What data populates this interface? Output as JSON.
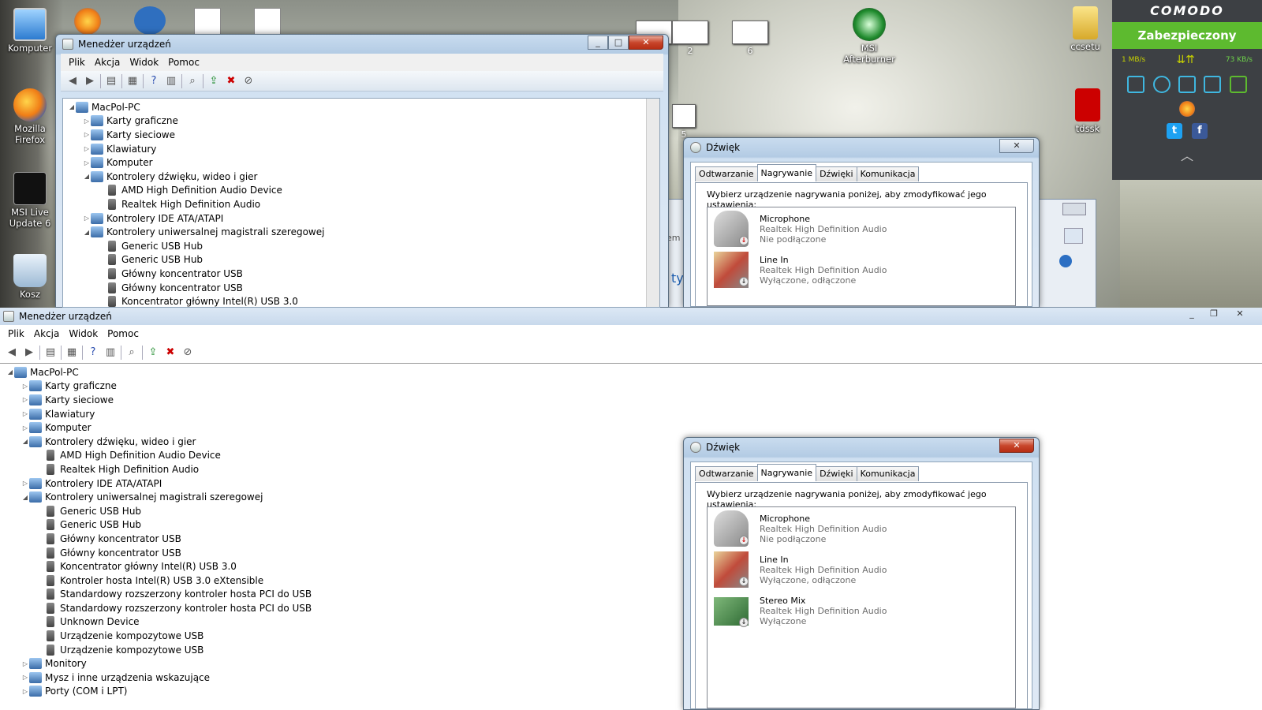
{
  "desktop": {
    "icons": [
      {
        "label": "Komputer"
      },
      {
        "label": "Mozilla Firefox"
      },
      {
        "label": "MSI Live Update 6"
      },
      {
        "label": "Kosz"
      },
      {
        "label": "MSI Afterburner"
      },
      {
        "label": "ccsetu"
      },
      {
        "label": "tdssk"
      }
    ],
    "thumb_labels": [
      "2",
      "6",
      "5"
    ]
  },
  "comodo": {
    "brand": "COMODO",
    "status": "Zabezpieczony",
    "download_speed": "1 MB/s",
    "upload_speed": "73 KB/s",
    "colors": {
      "bar": "#5dba2f",
      "panel": "#3d4044"
    }
  },
  "device_manager": {
    "title": "Menedżer urządzeń",
    "menu": [
      "Plik",
      "Akcja",
      "Widok",
      "Pomoc"
    ],
    "root": "MacPol-PC",
    "tree": [
      {
        "label": "Karty graficzne",
        "level": 1,
        "exp": "▷"
      },
      {
        "label": "Karty sieciowe",
        "level": 1,
        "exp": "▷"
      },
      {
        "label": "Klawiatury",
        "level": 1,
        "exp": "▷"
      },
      {
        "label": "Komputer",
        "level": 1,
        "exp": "▷"
      },
      {
        "label": "Kontrolery dźwięku, wideo i gier",
        "level": 1,
        "exp": "◢"
      },
      {
        "label": "AMD High Definition Audio Device",
        "level": 2,
        "exp": ""
      },
      {
        "label": "Realtek High Definition Audio",
        "level": 2,
        "exp": ""
      },
      {
        "label": "Kontrolery IDE ATA/ATAPI",
        "level": 1,
        "exp": "▷"
      },
      {
        "label": "Kontrolery uniwersalnej magistrali szeregowej",
        "level": 1,
        "exp": "◢"
      },
      {
        "label": "Generic USB Hub",
        "level": 2,
        "exp": ""
      },
      {
        "label": "Generic USB Hub",
        "level": 2,
        "exp": ""
      },
      {
        "label": "Główny koncentrator USB",
        "level": 2,
        "exp": ""
      },
      {
        "label": "Główny koncentrator USB",
        "level": 2,
        "exp": ""
      },
      {
        "label": "Koncentrator główny Intel(R) USB 3.0",
        "level": 2,
        "exp": ""
      },
      {
        "label": "Kontroler hosta Intel(R) USB 3.0 eXtensible",
        "level": 2,
        "exp": ""
      },
      {
        "label": "Standardowy rozszerzony kontroler hosta PCI do USB",
        "level": 2,
        "exp": ""
      },
      {
        "label": "Standardowy rozszerzony kontroler hosta PCI do USB",
        "level": 2,
        "exp": ""
      },
      {
        "label": "Unknown Device",
        "level": 2,
        "exp": ""
      },
      {
        "label": "Urządzenie kompozytowe USB",
        "level": 2,
        "exp": ""
      },
      {
        "label": "Urządzenie kompozytowe USB",
        "level": 2,
        "exp": ""
      },
      {
        "label": "Monitory",
        "level": 1,
        "exp": "▷"
      },
      {
        "label": "Mysz i inne urządzenia wskazujące",
        "level": 1,
        "exp": "▷"
      },
      {
        "label": "Porty (COM i LPT)",
        "level": 1,
        "exp": "▷"
      }
    ]
  },
  "sound": {
    "title": "Dźwięk",
    "tabs": [
      "Odtwarzanie",
      "Nagrywanie",
      "Dźwięki",
      "Komunikacja"
    ],
    "active_tab": "Nagrywanie",
    "hint": "Wybierz urządzenie nagrywania poniżej, aby zmodyfikować jego ustawienia:",
    "devices": [
      {
        "name": "Microphone",
        "driver": "Realtek High Definition Audio",
        "state": "Nie podłączone",
        "icon": "microphone-icon"
      },
      {
        "name": "Line In",
        "driver": "Realtek High Definition Audio",
        "state": "Wyłączone, odłączone",
        "icon": "line-in-icon"
      },
      {
        "name": "Stereo Mix",
        "driver": "Realtek High Definition Audio",
        "state": "Wyłączone",
        "icon": "sound-card-icon"
      }
    ]
  },
  "partial_window_text": [
    "em",
    "ty"
  ]
}
